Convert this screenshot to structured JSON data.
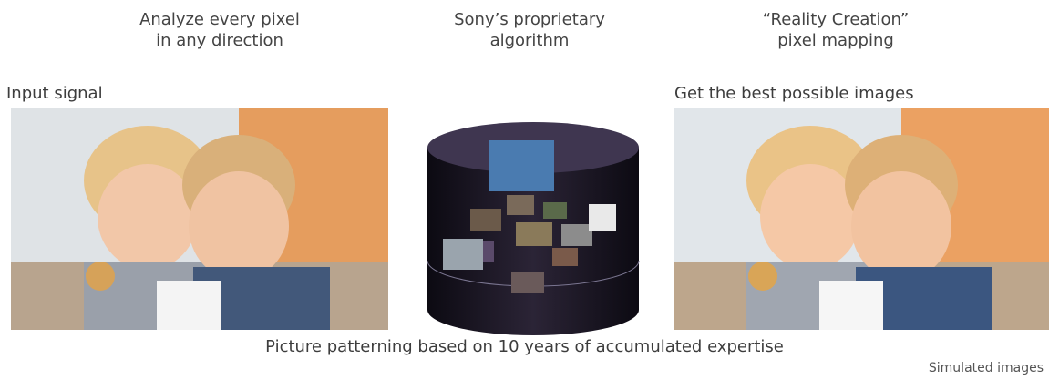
{
  "captions": [
    {
      "line1": "Analyze every pixel",
      "line2": "in any direction"
    },
    {
      "line1": "Sony’s proprietary",
      "line2": "algorithm"
    },
    {
      "line1": "“Reality Creation”",
      "line2": "pixel mapping"
    }
  ],
  "labels": {
    "input": "Input signal",
    "output": "Get the best possible images"
  },
  "footer": "Picture patterning based on 10 years of accumulated expertise",
  "note": "Simulated images"
}
